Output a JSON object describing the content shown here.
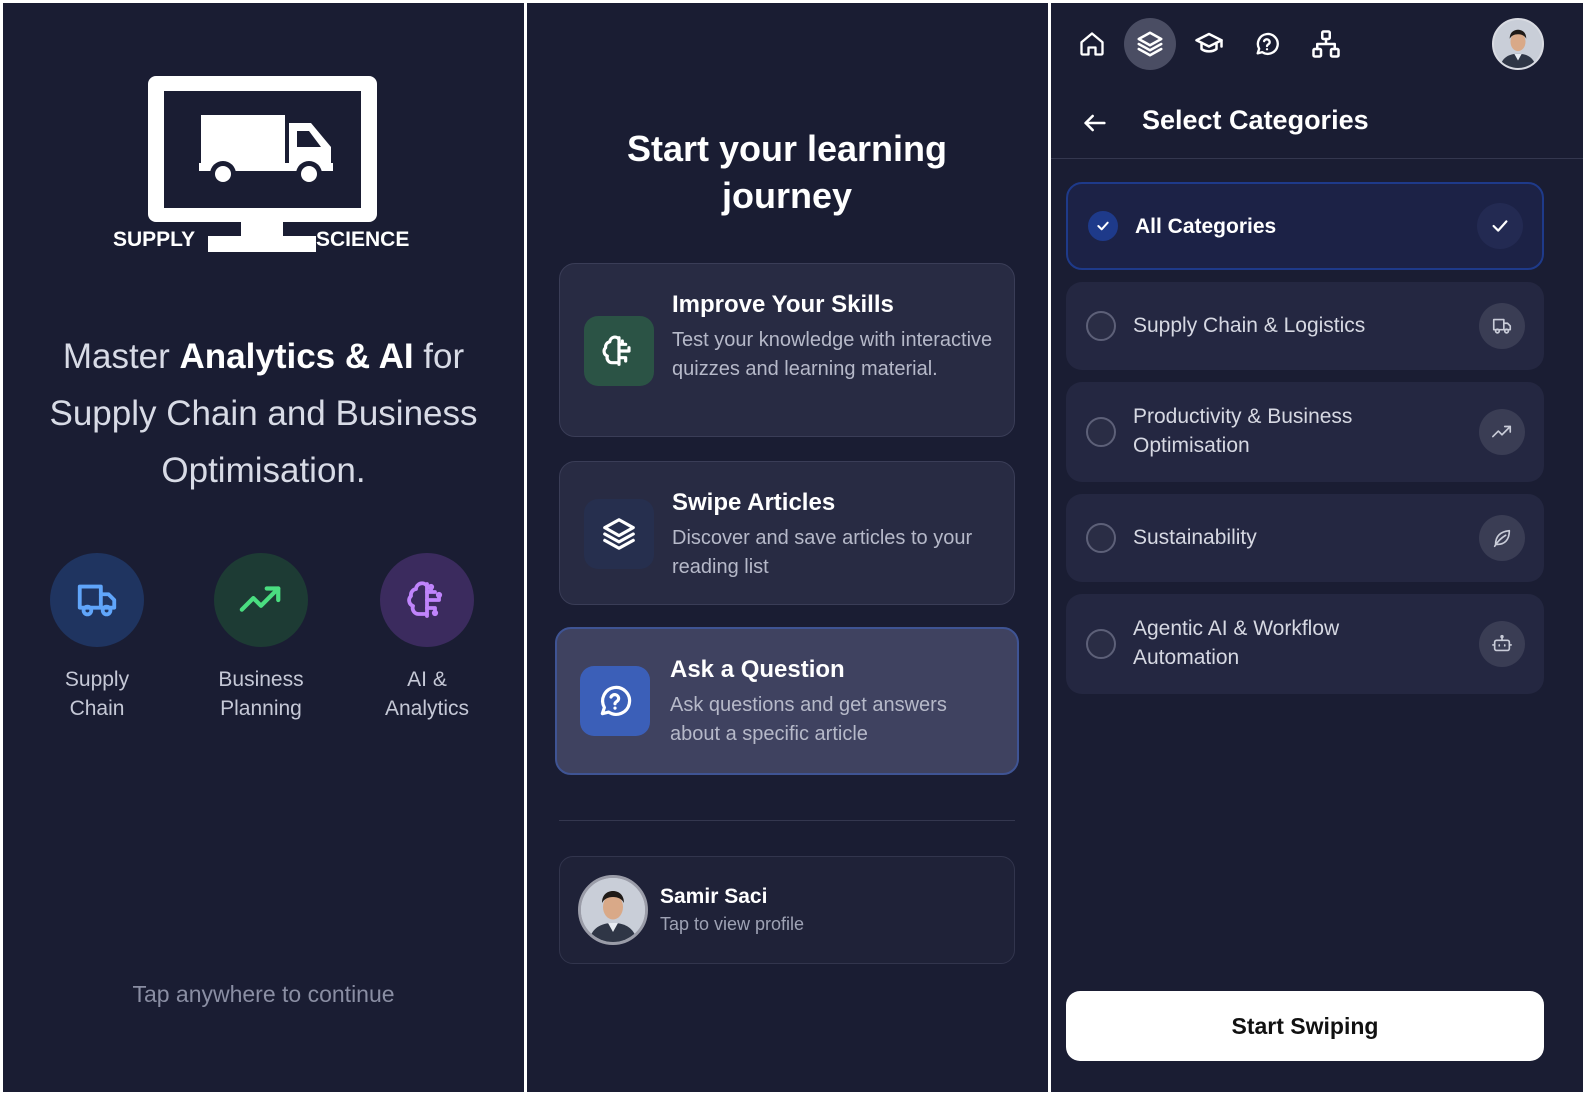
{
  "colors": {
    "panel_bg": "#1a1d33",
    "card_bg": "#282b43",
    "accent_blue": "#3f5494",
    "supply_icon": "#60a5fa",
    "business_icon": "#4ade80",
    "ai_icon": "#c084fc"
  },
  "welcome": {
    "logo": {
      "left_word": "SUPPLY",
      "right_word": "SCIENCE"
    },
    "tagline": {
      "prefix": "Master ",
      "bold": "Analytics & AI",
      "suffix": " for Supply Chain and Business Optimisation."
    },
    "features": [
      {
        "icon": "truck-icon",
        "label_line1": "Supply",
        "label_line2": "Chain"
      },
      {
        "icon": "trending-up-icon",
        "label_line1": "Business",
        "label_line2": "Planning"
      },
      {
        "icon": "brain-icon",
        "label_line1": "AI &",
        "label_line2": "Analytics"
      }
    ],
    "continue_hint": "Tap anywhere to continue"
  },
  "journey": {
    "title_line1": "Start your learning",
    "title_line2": "journey",
    "cards": [
      {
        "icon": "brain-icon",
        "title": "Improve Your Skills",
        "description": "Test your knowledge with interactive quizzes and learning material."
      },
      {
        "icon": "layers-icon",
        "title": "Swipe Articles",
        "description": "Discover and save articles to your reading list"
      },
      {
        "icon": "question-chat-icon",
        "title": "Ask a Question",
        "description": "Ask questions and get answers about a specific article"
      }
    ],
    "profile": {
      "name": "Samir Saci",
      "subtitle": "Tap to view profile"
    }
  },
  "categories": {
    "nav": [
      "home-icon",
      "layers-icon",
      "graduation-cap-icon",
      "question-chat-icon",
      "sitemap-icon"
    ],
    "active_nav": "layers-icon",
    "title": "Select Categories",
    "items": [
      {
        "label": "All Categories",
        "icon": "check-icon",
        "selected": true
      },
      {
        "label": "Supply Chain & Logistics",
        "icon": "truck-icon",
        "selected": false
      },
      {
        "label_line1": "Productivity & Business",
        "label_line2": "Optimisation",
        "icon": "trending-up-icon",
        "selected": false
      },
      {
        "label": "Sustainability",
        "icon": "leaf-icon",
        "selected": false
      },
      {
        "label_line1": "Agentic AI & Workflow",
        "label_line2": "Automation",
        "icon": "bot-icon",
        "selected": false
      }
    ],
    "start_button": "Start Swiping"
  }
}
